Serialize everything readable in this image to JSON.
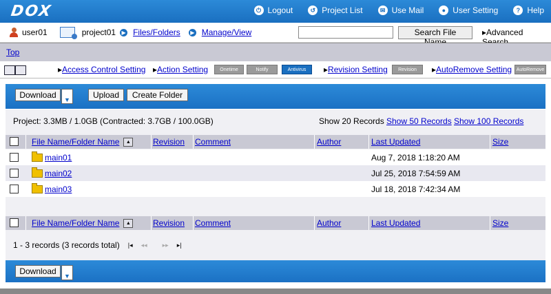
{
  "app": {
    "logo": "DOX"
  },
  "topnav": [
    {
      "label": "Logout",
      "icon": "logout-icon"
    },
    {
      "label": "Project List",
      "icon": "project-list-icon"
    },
    {
      "label": "Use Mail",
      "icon": "mail-icon"
    },
    {
      "label": "User Setting",
      "icon": "user-setting-icon"
    },
    {
      "label": "Help",
      "icon": "help-icon"
    }
  ],
  "user": {
    "name": "user01"
  },
  "project": {
    "name": "project01",
    "files_link": "Files/Folders",
    "manage_link": "Manage/View"
  },
  "search": {
    "value": "",
    "button": "Search File Name",
    "advanced": "Advanced Search"
  },
  "breadcrumb": {
    "top": "Top"
  },
  "settings": {
    "access_control": "Access Control Setting",
    "action": "Action Setting",
    "tag_onetime": "Onetime",
    "tag_notify": "Notify",
    "tag_antivirus": "Antivirus",
    "revision": "Revision Setting",
    "tag_revision": "Revision",
    "autoremove": "AutoRemove Setting",
    "tag_autoremove": "AutoRemove"
  },
  "toolbar": {
    "download": "Download",
    "upload": "Upload",
    "create_folder": "Create Folder"
  },
  "info": {
    "quota": "Project: 3.3MB / 1.0GB (Contracted: 3.7GB / 100.0GB)",
    "show_20": "Show 20 Records",
    "show_50": "Show 50 Records",
    "show_100": "Show 100 Records"
  },
  "table": {
    "columns": {
      "name": "File Name/Folder Name",
      "revision": "Revision",
      "comment": "Comment",
      "author": "Author",
      "updated": "Last Updated",
      "size": "Size"
    },
    "rows": [
      {
        "name": "main01",
        "revision": "",
        "comment": "",
        "author": "",
        "updated": "Aug 7, 2018 1:18:20 AM",
        "size": ""
      },
      {
        "name": "main02",
        "revision": "",
        "comment": "",
        "author": "",
        "updated": "Jul 25, 2018 7:54:59 AM",
        "size": ""
      },
      {
        "name": "main03",
        "revision": "",
        "comment": "",
        "author": "",
        "updated": "Jul 18, 2018 7:42:34 AM",
        "size": ""
      }
    ]
  },
  "pager": {
    "summary": "1 - 3 records (3 records total)",
    "first": "|◂",
    "prev": "◂◂",
    "next": "▸▸",
    "last": "▸|"
  },
  "colors": {
    "brand_blue": "#1a6fc0",
    "header_gray": "#c9c9d4",
    "link": "#0000cc"
  }
}
